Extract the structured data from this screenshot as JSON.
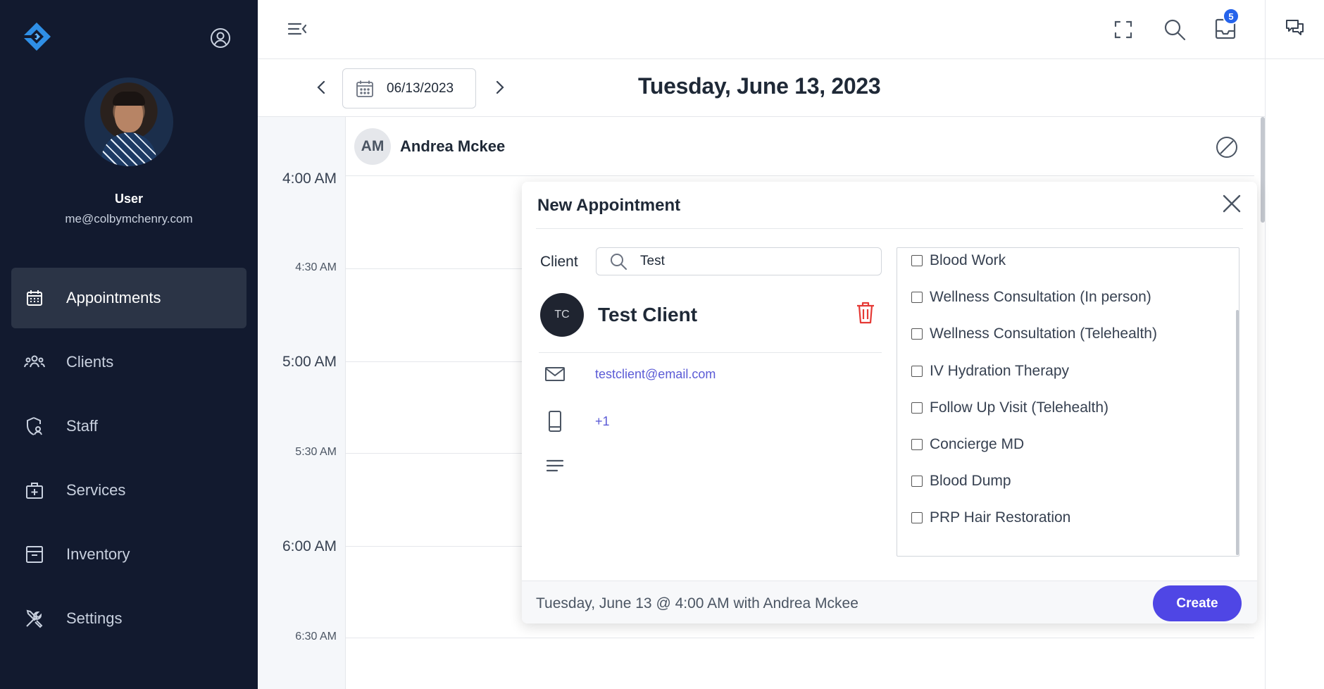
{
  "sidebar": {
    "user_name": "User",
    "user_email": "me@colbymchenry.com",
    "items": [
      {
        "label": "Appointments",
        "icon": "calendar-icon",
        "active": true
      },
      {
        "label": "Clients",
        "icon": "users-icon"
      },
      {
        "label": "Staff",
        "icon": "shield-user-icon"
      },
      {
        "label": "Services",
        "icon": "medical-bag-icon"
      },
      {
        "label": "Inventory",
        "icon": "archive-box-icon"
      },
      {
        "label": "Settings",
        "icon": "tools-icon"
      }
    ]
  },
  "topbar": {
    "notification_count": "5"
  },
  "datebar": {
    "date_value": "06/13/2023",
    "title": "Tuesday, June 13, 2023"
  },
  "calendar": {
    "times": [
      "4:00 AM",
      "4:30 AM",
      "5:00 AM",
      "5:30 AM",
      "6:00 AM",
      "6:30 AM"
    ],
    "staff": {
      "initials": "AM",
      "name": "Andrea Mckee"
    }
  },
  "modal": {
    "title": "New Appointment",
    "client_label": "Client",
    "search_value": "Test",
    "client": {
      "initials": "TC",
      "name": "Test Client",
      "email": "testclient@email.com",
      "phone": "+1"
    },
    "services": [
      "Blood Work",
      "Wellness Consultation (In person)",
      "Wellness Consultation (Telehealth)",
      "IV Hydration Therapy",
      "Follow Up Visit (Telehealth)",
      "Concierge MD",
      "Blood Dump",
      "PRP Hair Restoration"
    ],
    "summary": "Tuesday, June 13 @ 4:00 AM with Andrea Mckee",
    "create_label": "Create"
  },
  "colors": {
    "sidebar_bg": "#121a2f",
    "accent": "#4f46e5",
    "trash": "#e53935",
    "link": "#5b5bd6"
  }
}
